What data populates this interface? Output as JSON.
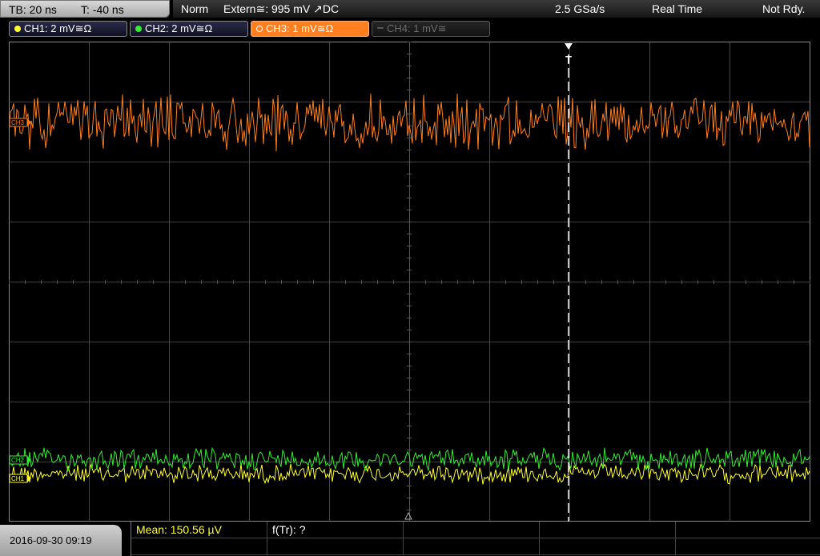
{
  "timebase": {
    "tb": "TB: 20 ns",
    "t": "T: -40 ns"
  },
  "status": {
    "mode": "Norm",
    "trigger": "Extern≅: 995 mV ↗DC",
    "sample_rate": "2.5 GSa/s",
    "acq": "Real Time",
    "state": "Not Rdy."
  },
  "channels": [
    {
      "label": "CH1: 2 mV≅Ω",
      "color": "#ffff33",
      "state": "on"
    },
    {
      "label": "CH2: 2 mV≅Ω",
      "color": "#33ee33",
      "state": "on"
    },
    {
      "label": "CH3: 1 mV≅Ω",
      "color": "#ff7e1f",
      "state": "active"
    },
    {
      "label": "CH4: 1 mV≅",
      "color": "#6d6d6d",
      "state": "off"
    }
  ],
  "markers": {
    "trigger": "T",
    "ch1": "CH1",
    "ch2": "CH2",
    "ch3": "CH3"
  },
  "colors": {
    "grid": "#555555",
    "ch1": "#ffff33",
    "ch2": "#33ee33",
    "ch3": "#ff7e1f",
    "trigger_line": "#ffffff"
  },
  "measurement": {
    "mean": "Mean: 150.56 µV",
    "freq": "f(Tr): ?"
  },
  "datetime": "2016-09-30 09:19"
}
